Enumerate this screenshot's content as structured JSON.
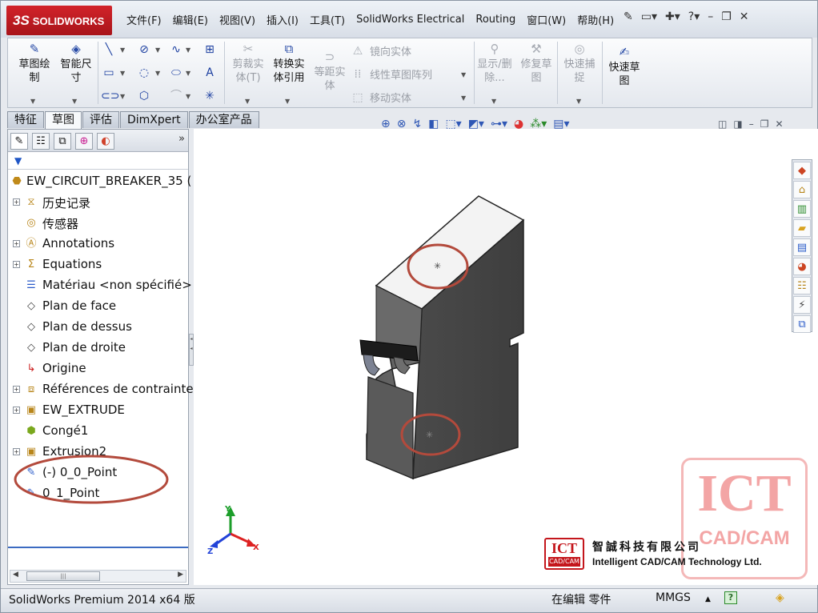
{
  "app": {
    "logo": "SOLIDWORKS",
    "logo_mark": "3S"
  },
  "menu": [
    "文件(F)",
    "编辑(E)",
    "视图(V)",
    "插入(I)",
    "工具(T)",
    "SolidWorks Electrical",
    "Routing",
    "窗口(W)",
    "帮助(H)"
  ],
  "toolbar": {
    "sketch": "草图绘制",
    "smart_dim": "智能尺寸",
    "trim": "剪裁实体(T)",
    "convert": "转换实体引用",
    "offset": "等距实体",
    "mirror": "镜向实体",
    "linear_pattern": "线性草图阵列",
    "move": "移动实体",
    "display_delete": "显示/删除...",
    "repair": "修复草图",
    "quick_snaps": "快速捕捉",
    "rapid_sketch": "快速草图"
  },
  "tabs": [
    "特征",
    "草图",
    "评估",
    "DimXpert",
    "办公室产品"
  ],
  "active_tab": 1,
  "tree": {
    "root": "EW_CIRCUIT_BREAKER_35  (",
    "items": [
      {
        "label": "历史记录",
        "icon": "history-icon",
        "expand": true
      },
      {
        "label": "传感器",
        "icon": "sensor-icon",
        "expand": false
      },
      {
        "label": "Annotations",
        "icon": "annotations-icon",
        "expand": true
      },
      {
        "label": "Equations",
        "icon": "equations-icon",
        "expand": true
      },
      {
        "label": "Matériau <non spécifié>",
        "icon": "material-icon",
        "expand": false
      },
      {
        "label": "Plan de face",
        "icon": "plane-icon",
        "expand": false
      },
      {
        "label": "Plan de dessus",
        "icon": "plane-icon",
        "expand": false
      },
      {
        "label": "Plan de droite",
        "icon": "plane-icon",
        "expand": false
      },
      {
        "label": "Origine",
        "icon": "origin-icon",
        "expand": false
      },
      {
        "label": "Références de contrainte",
        "icon": "mate-references-icon",
        "expand": true
      },
      {
        "label": "EW_EXTRUDE",
        "icon": "extrude-icon",
        "expand": true
      },
      {
        "label": "Congé1",
        "icon": "fillet-icon",
        "expand": false
      },
      {
        "label": "Extrusion2",
        "icon": "extrude-icon",
        "expand": true
      },
      {
        "label": "(-) 0_0_Point",
        "icon": "sketch-icon",
        "expand": false
      },
      {
        "label": "0_1_Point",
        "icon": "sketch-icon",
        "expand": false
      }
    ]
  },
  "triad": {
    "x": "X",
    "y": "Y",
    "z": "Z"
  },
  "watermark": {
    "big": "ICT",
    "small": "CAD/CAM"
  },
  "company": {
    "badge": "ICT",
    "badge_sub": "CAD/CAM",
    "name_zh": "智誠科技有限公司",
    "name_en": "Intelligent CAD/CAM Technology Ltd."
  },
  "status": {
    "product": "SolidWorks Premium 2014 x64 版",
    "mode": "在编辑 零件",
    "units": "MMGS",
    "units_arrow": "▲",
    "help": "?"
  },
  "colors": {
    "highlight_ellipse": "#b34a3c",
    "logo_red": "#c4161c",
    "triad_x": "#dd2222",
    "triad_y": "#1c9e2a",
    "triad_z": "#2243d8"
  }
}
